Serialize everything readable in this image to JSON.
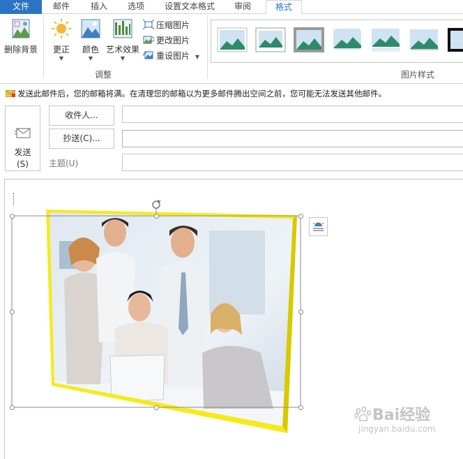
{
  "tabs": [
    {
      "label": "文件"
    },
    {
      "label": "邮件"
    },
    {
      "label": "插入"
    },
    {
      "label": "选项"
    },
    {
      "label": "设置文本格式"
    },
    {
      "label": "审阅"
    },
    {
      "label": "格式"
    }
  ],
  "ribbon": {
    "remove_bg": "删除背景",
    "corrections": "更正",
    "color": "颜色",
    "artistic": "艺术效果",
    "compress": "压缩图片",
    "change": "更改图片",
    "reset": "重设图片",
    "adjust_group": "调整",
    "styles_group": "图片样式"
  },
  "infobar": {
    "text": "发送此邮件后，您的邮箱将满。在清理您的邮箱以为更多邮件腾出空间之前，您可能无法发送其他邮件。"
  },
  "compose": {
    "send_line1": "发送",
    "send_line2": "(S)",
    "to_button": "收件人...",
    "cc_button": "抄送(C)...",
    "subject_label": "主题(U)",
    "to_value": "",
    "cc_value": "",
    "subject_value": ""
  },
  "watermark": {
    "brand": "Bai经验",
    "url": "jingyan.baidu.com"
  },
  "colors": {
    "accent": "#2b74c5",
    "picture_border": "#f5eb1a"
  }
}
